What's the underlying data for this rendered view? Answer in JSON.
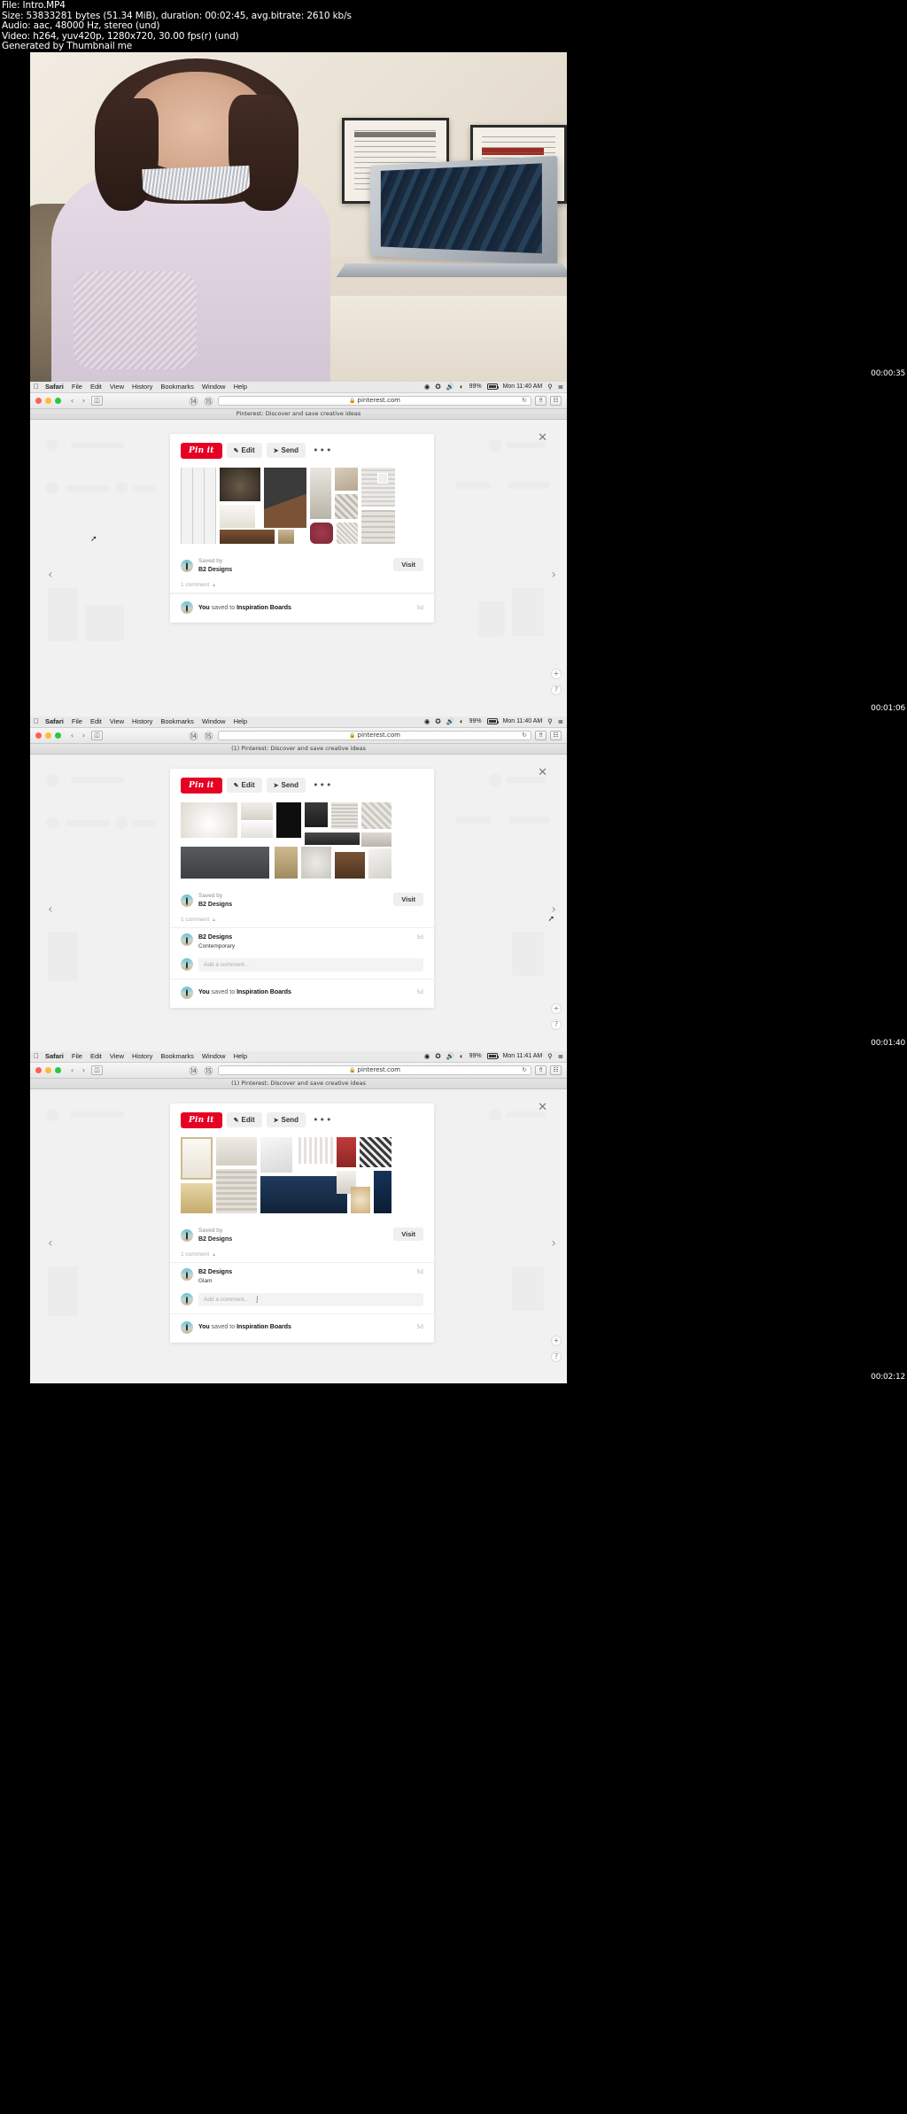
{
  "fileinfo": {
    "line1": "File: Intro.MP4",
    "line2": "Size: 53833281 bytes (51.34 MiB), duration: 00:02:45, avg.bitrate: 2610 kb/s",
    "line3": "Audio: aac, 48000 Hz, stereo (und)",
    "line4": "Video: h264, yuv420p, 1280x720, 30.00 fps(r) (und)",
    "line5": "Generated by Thumbnail me"
  },
  "timestamps": {
    "t1": "00:00:35",
    "t2": "00:01:06",
    "t3": "00:01:40",
    "t4": "00:02:12"
  },
  "menubar": {
    "apple": "",
    "items": [
      "Safari",
      "File",
      "Edit",
      "View",
      "History",
      "Bookmarks",
      "Window",
      "Help"
    ],
    "status": {
      "battery_pct": "99%",
      "clock": "Mon 11:40 AM",
      "clock_late": "Mon 11:41 AM",
      "search_icon": "search-icon",
      "list_icon": "control-center-icon",
      "wifi_icon": "wifi-icon",
      "volume_icon": "volume-icon",
      "dropbox_icon": "dropbox-icon",
      "record_icon": "record-icon"
    }
  },
  "toolbar": {
    "back": "‹",
    "forward": "›",
    "sidebar_icon": "sidebar-icon",
    "zoom_out": "⓪",
    "zoom_in": "⓪",
    "lock": "🔒",
    "url": "pinterest.com",
    "reload": "↻",
    "share_icon": "share-icon",
    "tabs_icon": "tabs-icon"
  },
  "tabbar": {
    "title": "Pinterest: Discover and save creative ideas",
    "title_with_badge": "(1) Pinterest: Discover and save creative ideas"
  },
  "card": {
    "pinit": "Pin it",
    "edit": "Edit",
    "send": "Send",
    "more": "•••",
    "saved_by_label": "Saved by",
    "saved_by_user": "B2 Designs",
    "visit": "Visit",
    "comment_count": "1 comment",
    "add_placeholder": "Add a comment...",
    "saved_to_you": "You",
    "saved_to_mid": " saved to ",
    "saved_to_board": "Inspiration Boards",
    "when": "5d",
    "close": "✕",
    "prev": "‹",
    "next": "›",
    "plus": "+",
    "help": "?"
  },
  "panels": [
    {
      "id": "panel-1",
      "timestamp": "00:00:35",
      "tab_title": "Pinterest: Discover and save creative ideas",
      "clock": "Mon 11:40 AM",
      "comment_author": "",
      "comment_text": "",
      "has_comment": false,
      "has_add_comment": false
    },
    {
      "id": "panel-2",
      "timestamp": "00:01:06",
      "tab_title": "(1) Pinterest: Discover and save creative ideas",
      "clock": "Mon 11:40 AM",
      "comment_author": "B2 Designs",
      "comment_text": "Contemporary",
      "has_comment": true,
      "has_add_comment": true
    },
    {
      "id": "panel-3",
      "timestamp": "00:01:40",
      "tab_title": "(1) Pinterest: Discover and save creative ideas",
      "clock": "Mon 11:41 AM",
      "comment_author": "B2 Designs",
      "comment_text": "Glam",
      "has_comment": true,
      "has_add_comment": true
    }
  ],
  "colors": {
    "pinterest_red": "#e60023",
    "page_bg": "#f1f1f1",
    "card_bg": "#ffffff",
    "chrome_bg": "#e9e9e9"
  }
}
